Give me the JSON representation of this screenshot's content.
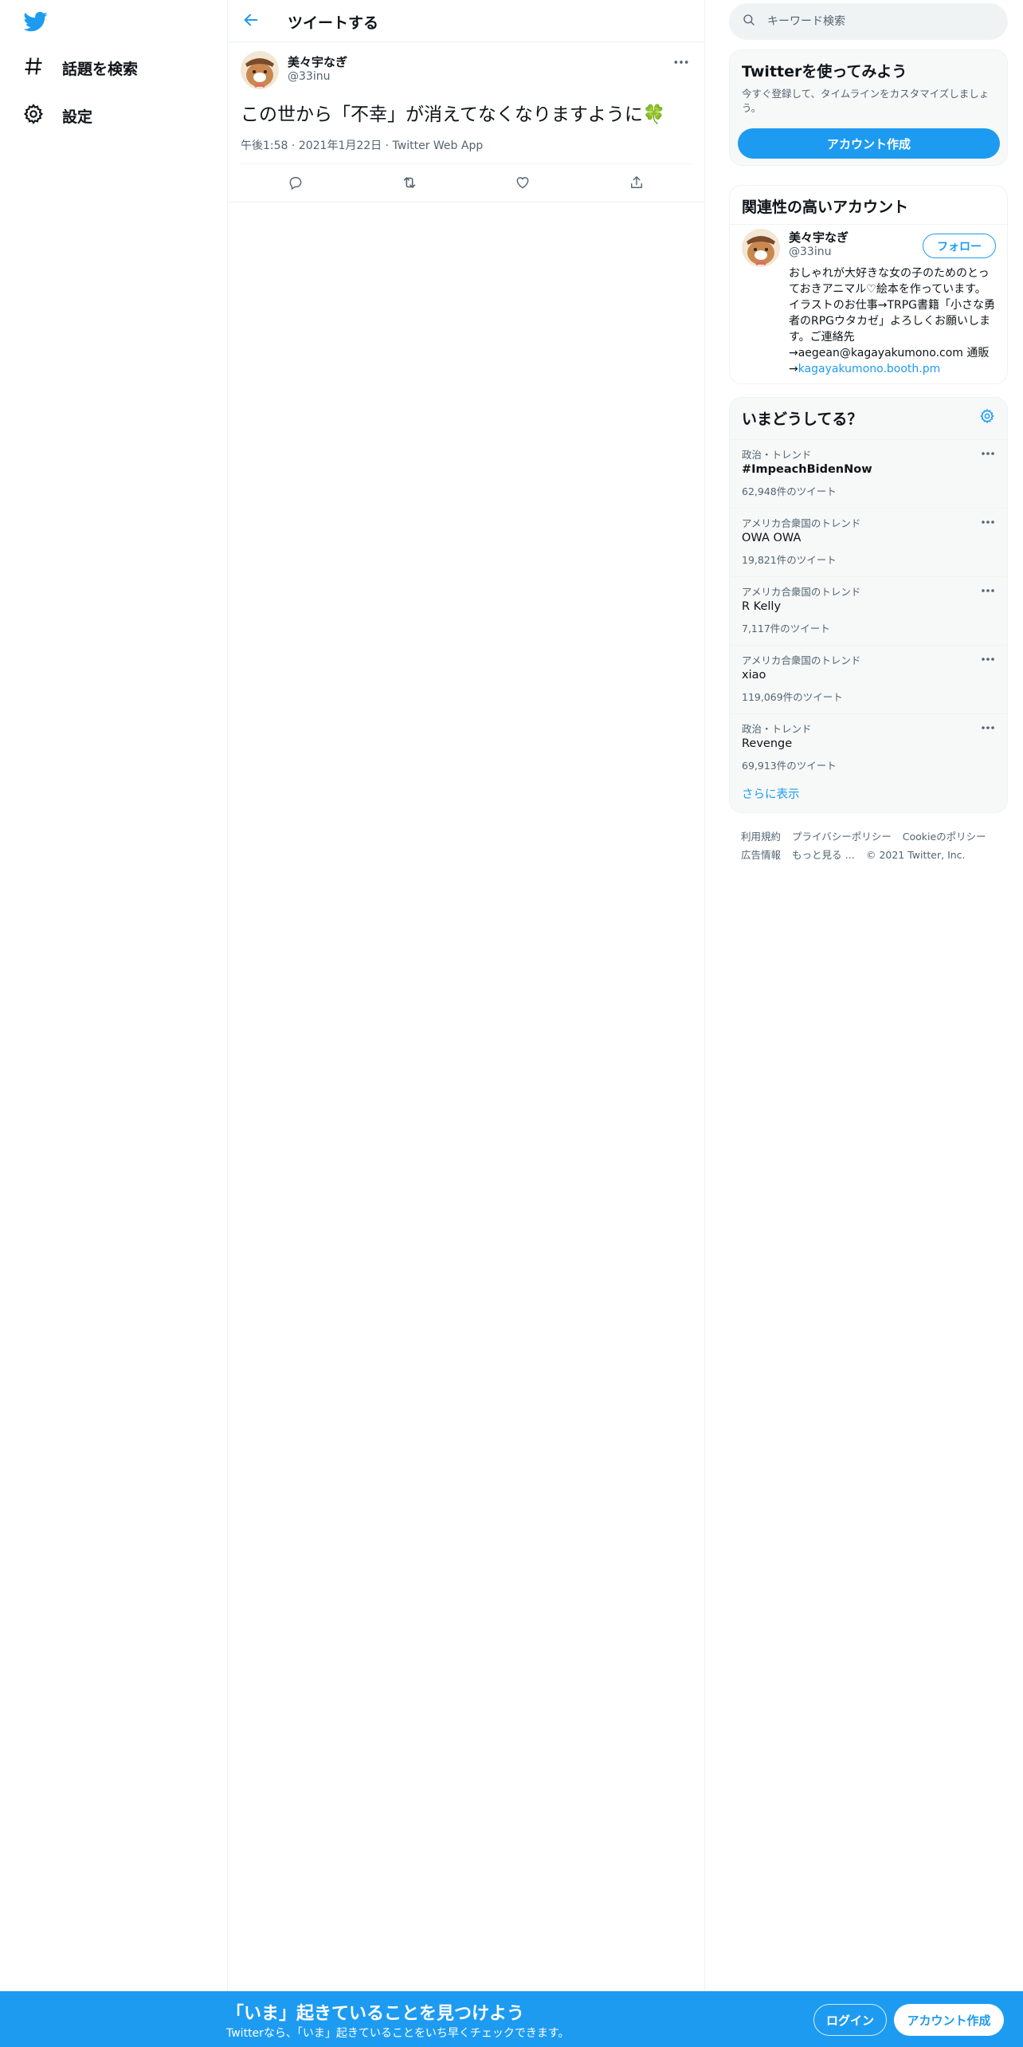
{
  "colors": {
    "brand": "#1d9bf0",
    "text_primary": "#0f1419",
    "text_secondary": "#536471",
    "border": "#eff3f4"
  },
  "left_nav": {
    "logo_icon": "twitter-bird-icon",
    "items": [
      {
        "icon": "hashtag-icon",
        "label": "話題を検索"
      },
      {
        "icon": "gear-icon",
        "label": "設定"
      }
    ]
  },
  "header": {
    "back_icon": "arrow-left-icon",
    "title": "ツイートする"
  },
  "tweet": {
    "author_name": "美々宇なぎ",
    "author_handle": "@33inu",
    "text": "この世から「不幸」が消えてなくなりますように",
    "emoji": "🍀",
    "time": "午後1:58",
    "date": "2021年1月22日",
    "source": "Twitter Web App",
    "actions": [
      "reply-icon",
      "retweet-icon",
      "like-icon",
      "share-icon"
    ]
  },
  "search": {
    "placeholder": "キーワード検索"
  },
  "signup_card": {
    "title": "Twitterを使ってみよう",
    "description": "今すぐ登録して、タイムラインをカスタマイズしましょう。",
    "button": "アカウント作成"
  },
  "related": {
    "title": "関連性の高いアカウント",
    "name": "美々宇なぎ",
    "handle": "@33inu",
    "follow_label": "フォロー",
    "bio": "おしゃれが大好きな女の子のためのとっておきアニマル♡絵本を作っています。 イラストのお仕事→TRPG書籍「小さな勇者のRPGウタカゼ」よろしくお願いします。ご連絡先→aegean@kagayakumono.com 通販→",
    "bio_link": "kagayakumono.booth.pm"
  },
  "trends": {
    "title": "いまどうしてる？",
    "items": [
      {
        "meta": "政治・トレンド",
        "name": "#ImpeachBidenNow",
        "count": "62,948件のツイート"
      },
      {
        "meta": "アメリカ合衆国のトレンド",
        "name": "OWA OWA",
        "count": "19,821件のツイート"
      },
      {
        "meta": "アメリカ合衆国のトレンド",
        "name": "R Kelly",
        "count": "7,117件のツイート"
      },
      {
        "meta": "アメリカ合衆国のトレンド",
        "name": "xiao",
        "count": "119,069件のツイート"
      },
      {
        "meta": "政治・トレンド",
        "name": "Revenge",
        "count": "69,913件のツイート"
      }
    ],
    "show_more": "さらに表示"
  },
  "footer": {
    "links": [
      "利用規約",
      "プライバシーポリシー",
      "Cookieのポリシー",
      "広告情報",
      "もっと見る …"
    ],
    "copyright": "© 2021 Twitter, Inc."
  },
  "bottom_bar": {
    "title": "「いま」起きていることを見つけよう",
    "subtitle": "Twitterなら、「いま」起きていることをいち早くチェックできます。",
    "login": "ログイン",
    "signup": "アカウント作成"
  }
}
